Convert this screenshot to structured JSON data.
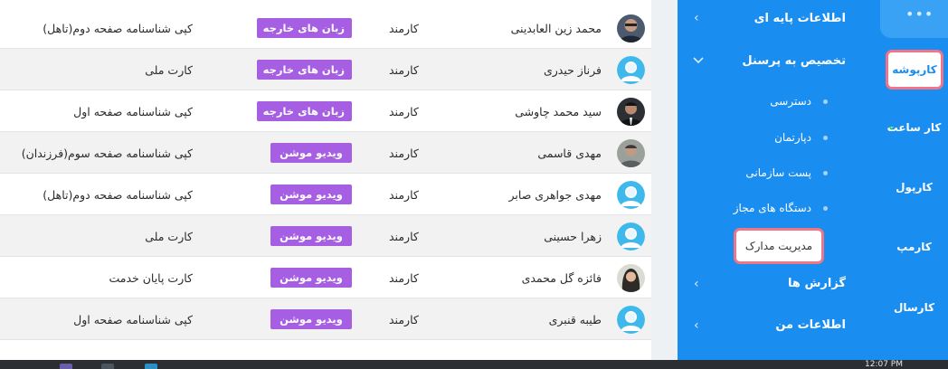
{
  "table": {
    "rows": [
      {
        "name": "محمد زین العابدینی",
        "role": "کارمند",
        "badge": "زبان های خارجه",
        "document": "کپی شناسنامه صفحه دوم(تاهل)",
        "avatar": "photo-man-glasses",
        "alt": false
      },
      {
        "name": "فرناز حیدری",
        "role": "کارمند",
        "badge": "زبان های خارجه",
        "document": "کارت ملی",
        "avatar": "default-avatar",
        "alt": true
      },
      {
        "name": "سید محمد چاوشی",
        "role": "کارمند",
        "badge": "زبان های خارجه",
        "document": "کپی شناسنامه صفحه اول",
        "avatar": "photo-man-suit",
        "alt": false
      },
      {
        "name": "مهدی قاسمی",
        "role": "کارمند",
        "badge": "ویدیو موشن",
        "document": "کپی شناسنامه صفحه سوم(فرزندان)",
        "avatar": "photo-man-grey",
        "alt": true
      },
      {
        "name": "مهدی جواهری صابر",
        "role": "کارمند",
        "badge": "ویدیو موشن",
        "document": "کپی شناسنامه صفحه دوم(تاهل)",
        "avatar": "default-avatar",
        "alt": false
      },
      {
        "name": "زهرا حسینی",
        "role": "کارمند",
        "badge": "ویدیو موشن",
        "document": "کارت ملی",
        "avatar": "default-avatar",
        "alt": true
      },
      {
        "name": "فائزه گل محمدی",
        "role": "کارمند",
        "badge": "ویدیو موشن",
        "document": "کارت پایان خدمت",
        "avatar": "photo-woman-hijab",
        "alt": false
      },
      {
        "name": "طیبه قنبری",
        "role": "کارمند",
        "badge": "ویدیو موشن",
        "document": "کپی شناسنامه صفحه اول",
        "avatar": "default-avatar",
        "alt": true
      }
    ]
  },
  "menu": {
    "base_info": "اطلاعات پایه ای",
    "personnel_assignment": "تخصیص به پرسنل",
    "sub_items": [
      "دسترسی",
      "دپارتمان",
      "پست سازمانی",
      "دستگاه های مجاز"
    ],
    "active_sub": "مدیریت مدارک",
    "reports": "گزارش ها",
    "my_info": "اطلاعات من"
  },
  "rail": {
    "more": "•••",
    "active": "کارپوشه",
    "items": [
      "کار ساعت",
      "کارپول",
      "کارمپ",
      "کارسال"
    ]
  },
  "taskbar": {
    "clock": "12:07 PM"
  },
  "colors": {
    "primary": "#1a8df0",
    "badge": "#a65fe3",
    "highlight": "#f07586",
    "online_dot": "#32d26a"
  }
}
